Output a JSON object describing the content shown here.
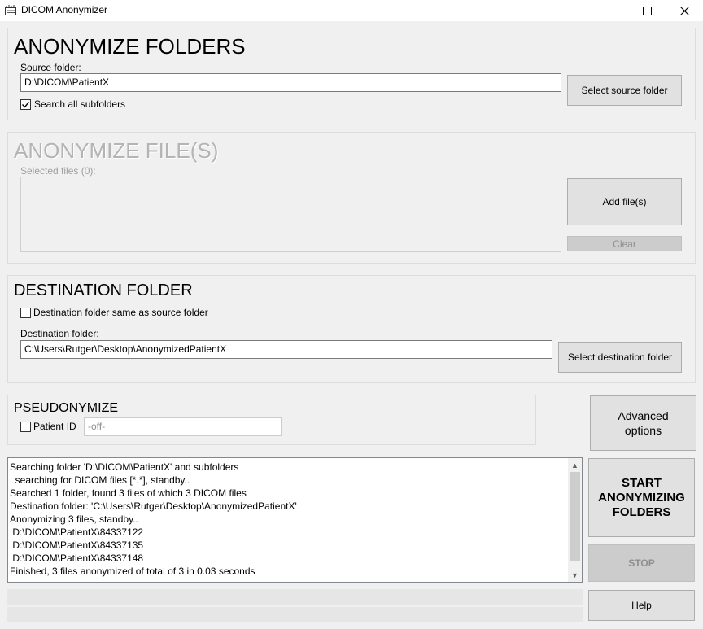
{
  "window": {
    "title": "DICOM Anonymizer",
    "icons": {
      "app": "dicom-app-icon",
      "minimize": "minimize-icon",
      "maximize": "maximize-icon",
      "close": "close-icon"
    }
  },
  "anonymize_folders": {
    "heading": "ANONYMIZE FOLDERS",
    "source_label": "Source folder:",
    "source_value": "D:\\DICOM\\PatientX",
    "subfolders_label": "Search all subfolders",
    "subfolders_checked": true,
    "select_button": "Select source folder"
  },
  "anonymize_files": {
    "heading": "ANONYMIZE FILE(S)",
    "selected_label": "Selected files (0):",
    "add_button": "Add file(s)",
    "clear_button": "Clear"
  },
  "destination": {
    "heading": "DESTINATION FOLDER",
    "same_label": "Destination folder same as source folder",
    "same_checked": false,
    "dest_label": "Destination folder:",
    "dest_value": "C:\\Users\\Rutger\\Desktop\\AnonymizedPatientX",
    "select_button": "Select destination folder"
  },
  "pseudonymize": {
    "heading": "PSEUDONYMIZE",
    "patient_id_label": "Patient ID",
    "patient_id_checked": false,
    "patient_id_placeholder": "-off-"
  },
  "buttons": {
    "advanced_line1": "Advanced",
    "advanced_line2": "options",
    "start_line1": "START",
    "start_line2": "ANONYMIZING",
    "start_line3": "FOLDERS",
    "stop": "STOP",
    "help": "Help"
  },
  "log": {
    "lines": [
      "Searching folder 'D:\\DICOM\\PatientX' and subfolders",
      "  searching for DICOM files [*.*], standby..",
      "Searched 1 folder, found 3 files of which 3 DICOM files",
      "Destination folder: 'C:\\Users\\Rutger\\Desktop\\AnonymizedPatientX'",
      "Anonymizing 3 files, standby..",
      " D:\\DICOM\\PatientX\\84337122",
      " D:\\DICOM\\PatientX\\84337135",
      " D:\\DICOM\\PatientX\\84337148",
      "Finished, 3 files anonymized of total of 3 in 0.03 seconds"
    ]
  },
  "colors": {
    "background": "#f0f0f0",
    "disabled_text": "#a0a0a0",
    "button_face": "#e1e1e1",
    "disabled_button": "#cccccc"
  }
}
